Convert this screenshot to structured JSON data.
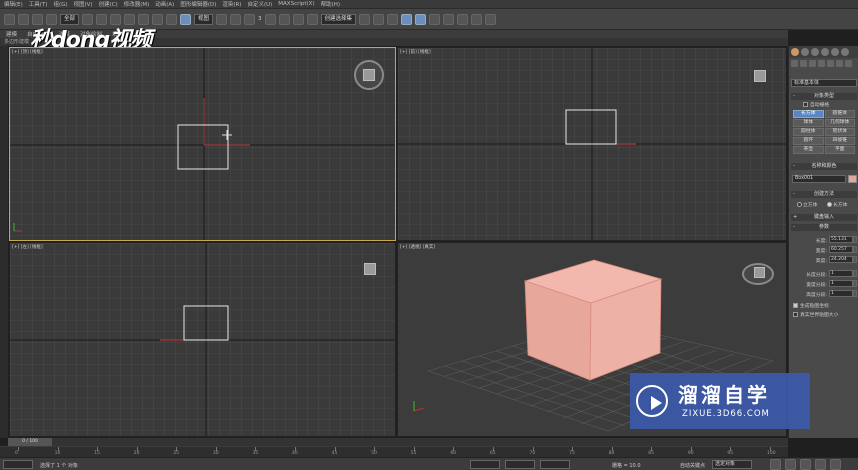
{
  "menubar": {
    "items": [
      "编辑(E)",
      "工具(T)",
      "组(G)",
      "视图(V)",
      "创建(C)",
      "修改器(M)",
      "动画(A)",
      "图形编辑器(D)",
      "渲染(R)",
      "自定义(U)",
      "MAXScript(X)",
      "帮助(H)"
    ]
  },
  "toolbar": {
    "filter_value": "全部",
    "view_value": "视图",
    "snap_value": "3",
    "selection_set": "创建选择集"
  },
  "ribbon": {
    "items": [
      "建模",
      "自由形式",
      "选择",
      "对象绘制",
      "填充"
    ],
    "tab_label": "多边形建模"
  },
  "viewports": {
    "top": {
      "label": "[+] [顶] [线框]"
    },
    "front": {
      "label": "[+] [前] [线框]"
    },
    "left": {
      "label": "[+] [左] [线框]"
    },
    "perspective": {
      "label": "[+] [透视] [真实]"
    }
  },
  "command_panel": {
    "category": "标准基本体",
    "object_type_header": "对象类型",
    "autogrid_label": "自动栅格",
    "buttons": [
      "长方体",
      "圆锥体",
      "球体",
      "几何球体",
      "圆柱体",
      "管状体",
      "圆环",
      "四棱锥",
      "茶壶",
      "平面"
    ],
    "active_button": "长方体",
    "name_color_header": "名称和颜色",
    "object_name": "Box001",
    "object_color": "#e0a898",
    "creation_method_header": "创建方法",
    "cube_label": "立方体",
    "box_label": "长方体",
    "keyboard_entry_header": "键盘输入",
    "params_header": "参数",
    "length_label": "长度:",
    "length_value": "55.131",
    "width_label": "宽度:",
    "width_value": "60.257",
    "height_label": "高度:",
    "height_value": "24.204",
    "length_segs_label": "长度分段:",
    "length_segs": "1",
    "width_segs_label": "宽度分段:",
    "width_segs": "1",
    "height_segs_label": "高度分段:",
    "height_segs": "1",
    "gen_map_label": "生成贴图坐标",
    "real_world_label": "真实世界贴图大小"
  },
  "timeline": {
    "slider": "0 / 100",
    "ticks": [
      "0",
      "10",
      "15",
      "20",
      "25",
      "30",
      "35",
      "40",
      "45",
      "50",
      "55",
      "60",
      "65",
      "70",
      "75",
      "80",
      "85",
      "90",
      "95",
      "100"
    ]
  },
  "status": {
    "selected_text": "选择了 1 个 对象",
    "grid_text": "栅格 = 10.0",
    "autokey_label": "自动关键点",
    "selected_obj": "选定对象"
  },
  "watermark": {
    "logo_text": "秒dong视频",
    "brand_title": "溜溜自学",
    "brand_url": "ZIXUE.3D66.COM"
  },
  "colors": {
    "box_face": "#e5a89c",
    "active_border": "#c9a84a",
    "accent": "#5a86c6"
  }
}
